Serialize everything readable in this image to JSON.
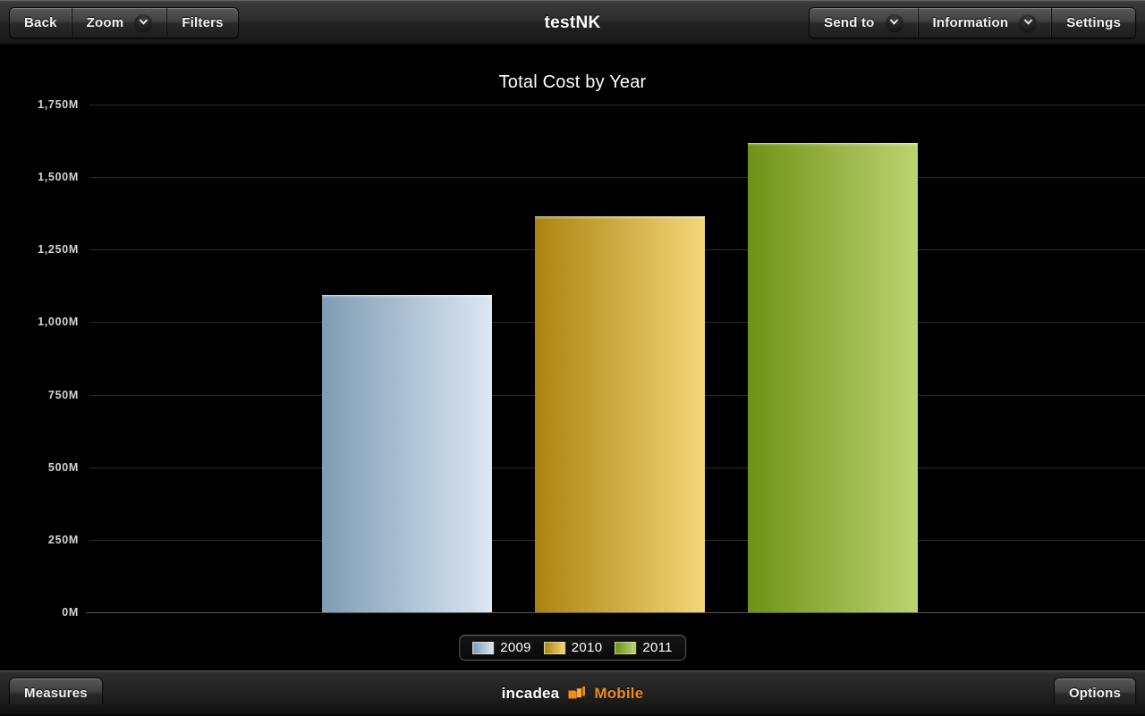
{
  "window": {
    "title": "testNK"
  },
  "toolbar": {
    "left_buttons": [
      {
        "label": "Back",
        "icon": null
      },
      {
        "label": "Zoom",
        "icon": "chevron-down-icon"
      },
      {
        "label": "Filters",
        "icon": null
      }
    ],
    "right_buttons": [
      {
        "label": "Send to",
        "icon": "chevron-down-icon"
      },
      {
        "label": "Information",
        "icon": "chevron-down-icon"
      },
      {
        "label": "Settings",
        "icon": null
      }
    ]
  },
  "bottombar": {
    "measures_label": "Measures",
    "options_label": "Options",
    "brand_name": "incadea",
    "brand_mark": "flag-icon",
    "brand_product": "Mobile",
    "brand_color": "#f08a1e"
  },
  "chart_data": {
    "type": "bar",
    "title": "Total Cost by Year",
    "xlabel": "",
    "ylabel": "",
    "categories": [
      "2009",
      "2010",
      "2011"
    ],
    "values": [
      1094,
      1365,
      1617
    ],
    "value_unit": "M",
    "ylim": [
      0,
      1750
    ],
    "yticks": [
      0,
      250,
      500,
      750,
      1000,
      1250,
      1500,
      1750
    ],
    "ytick_labels": [
      "0M",
      "250M",
      "500M",
      "750M",
      "1,000M",
      "1,250M",
      "1,500M",
      "1,750M"
    ],
    "grid": true,
    "legend_position": "bottom-center",
    "series": [
      {
        "name": "2009",
        "value": 1094,
        "color_from": "#7e9cb4",
        "color_to": "#dbe7f1"
      },
      {
        "name": "2010",
        "value": 1365,
        "color_from": "#ab8310",
        "color_to": "#f3d778"
      },
      {
        "name": "2011",
        "value": 1617,
        "color_from": "#6e9116",
        "color_to": "#bdd471"
      }
    ]
  }
}
